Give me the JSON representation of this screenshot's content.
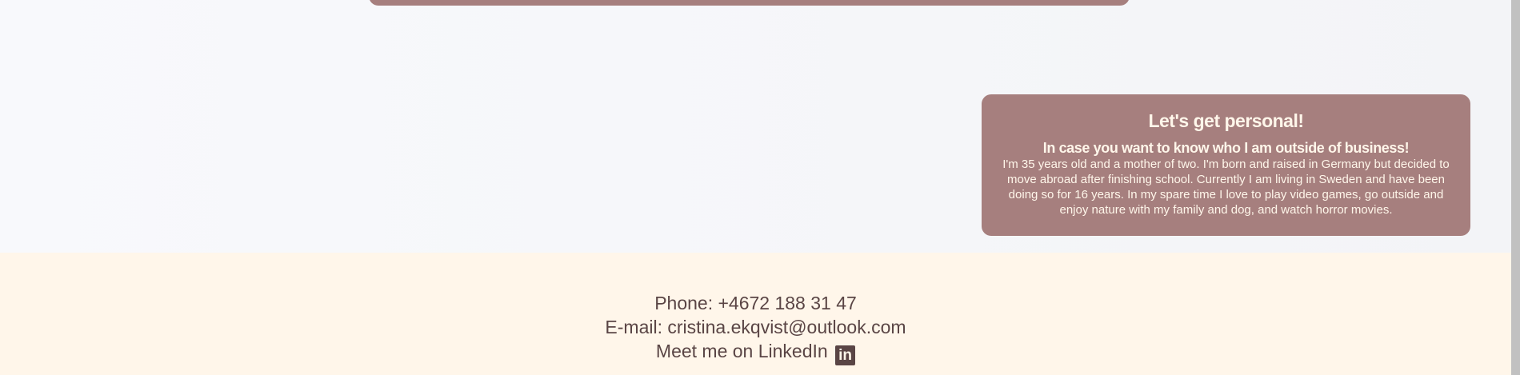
{
  "personal_card": {
    "title": "Let's get personal!",
    "subtitle": "In case you want to know who I am outside of business!",
    "body": "I'm 35 years old and a mother of two. I'm born and raised in Germany but decided to move abroad after finishing school. Currently I am living in Sweden and have been doing so for 16 years. In my spare time I love to play video games, go outside and enjoy nature with my family and dog, and watch horror movies."
  },
  "footer": {
    "phone": "Phone: +4672 188 31 47",
    "email": "E-mail: cristina.ekqvist@outlook.com",
    "linkedin": "Meet me on LinkedIn",
    "linkedin_icon": "in"
  }
}
